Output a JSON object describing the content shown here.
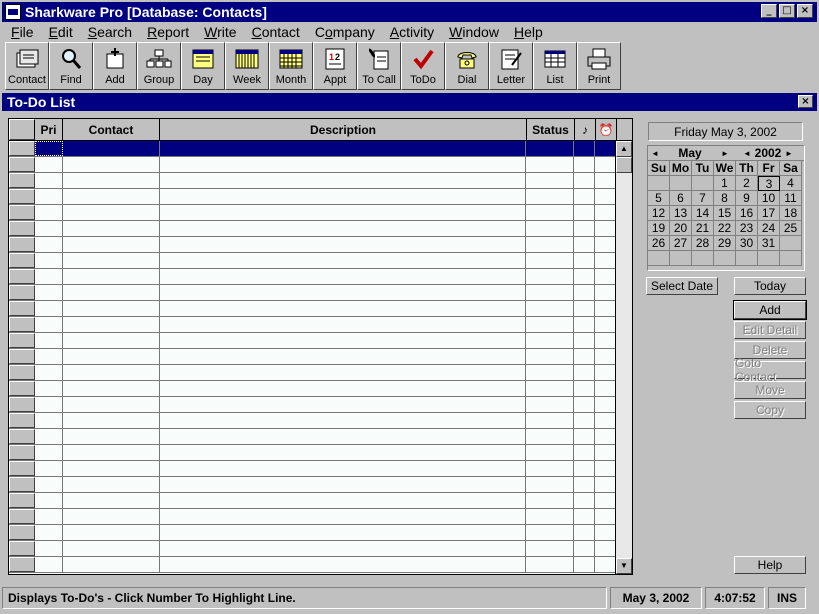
{
  "window": {
    "title": "Sharkware Pro  [Database: Contacts]",
    "minimize": "_",
    "maximize": "□",
    "close": "×"
  },
  "menu": [
    {
      "label": "File",
      "u": "F",
      "rest": "ile"
    },
    {
      "label": "Edit",
      "u": "E",
      "rest": "dit"
    },
    {
      "label": "Search",
      "u": "S",
      "rest": "earch"
    },
    {
      "label": "Report",
      "u": "R",
      "rest": "eport"
    },
    {
      "label": "Write",
      "u": "W",
      "rest": "rite"
    },
    {
      "label": "Contact",
      "u": "C",
      "rest": "ontact"
    },
    {
      "label": "Company",
      "u": "o",
      "pre": "C",
      "rest": "mpany"
    },
    {
      "label": "Activity",
      "u": "A",
      "rest": "ctivity"
    },
    {
      "label": "Window",
      "u": "W",
      "rest": "indow"
    },
    {
      "label": "Help",
      "u": "H",
      "rest": "elp"
    }
  ],
  "toolbar": [
    {
      "label": "Contact",
      "icon": "contact-cards-icon"
    },
    {
      "label": "Find",
      "icon": "magnifier-icon"
    },
    {
      "label": "Add",
      "icon": "add-card-icon"
    },
    {
      "label": "Group",
      "icon": "group-icon"
    },
    {
      "label": "Day",
      "icon": "day-calendar-icon"
    },
    {
      "label": "Week",
      "icon": "week-calendar-icon"
    },
    {
      "label": "Month",
      "icon": "month-calendar-icon"
    },
    {
      "label": "Appt",
      "icon": "appointment-icon"
    },
    {
      "label": "To Call",
      "icon": "phone-list-icon"
    },
    {
      "label": "ToDo",
      "icon": "checkmark-icon"
    },
    {
      "label": "Dial",
      "icon": "telephone-icon"
    },
    {
      "label": "Letter",
      "icon": "letter-icon"
    },
    {
      "label": "List",
      "icon": "list-icon"
    },
    {
      "label": "Print",
      "icon": "printer-icon"
    }
  ],
  "child_window": {
    "title": "To-Do List",
    "close": "×"
  },
  "grid": {
    "columns": [
      "Pri",
      "Contact",
      "Description",
      "Status",
      "♪",
      "⏰"
    ]
  },
  "calendar": {
    "current_date": "Friday  May 3, 2002",
    "month": "May",
    "year": "2002",
    "prev_month": "◄",
    "next_month": "►",
    "prev_year": "◄",
    "next_year": "►",
    "weekdays": [
      "Su",
      "Mo",
      "Tu",
      "We",
      "Th",
      "Fr",
      "Sa"
    ],
    "days": [
      "",
      "",
      "",
      "1",
      "2",
      "3",
      "4",
      "5",
      "6",
      "7",
      "8",
      "9",
      "10",
      "11",
      "12",
      "13",
      "14",
      "15",
      "16",
      "17",
      "18",
      "19",
      "20",
      "21",
      "22",
      "23",
      "24",
      "25",
      "26",
      "27",
      "28",
      "29",
      "30",
      "31",
      "",
      "",
      "",
      "",
      "",
      "",
      "",
      ""
    ],
    "selected_day": "3"
  },
  "buttons": {
    "select_date": "Select Date",
    "today": "Today",
    "add": "Add",
    "edit_detail": "Edit Detail",
    "delete": "Delete",
    "goto_contact": "Goto Contact",
    "move": "Move",
    "copy": "Copy",
    "help": "Help"
  },
  "statusbar": {
    "message": "Displays To-Do's - Click Number To Highlight Line.",
    "date": "May 3, 2002",
    "time": "4:07:52",
    "mode": "INS"
  }
}
